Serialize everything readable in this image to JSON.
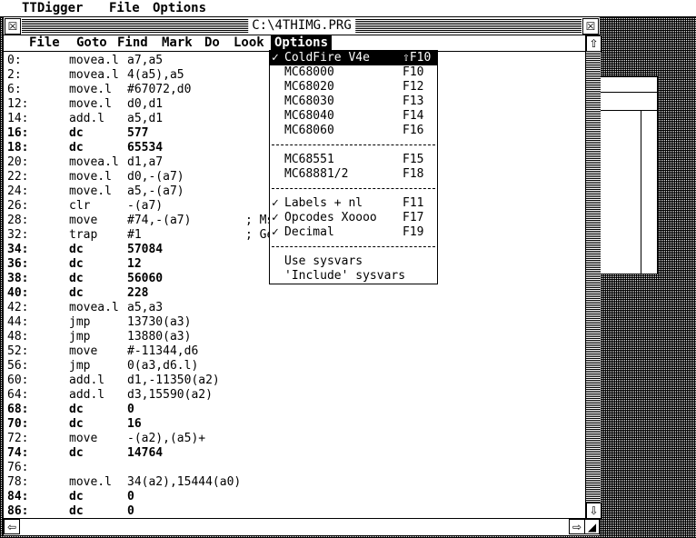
{
  "app_menu": [
    "TTDigger",
    "File",
    "Options"
  ],
  "window": {
    "title": "C:\\4THIMG.PRG",
    "menu": [
      "File",
      "Goto",
      "Find",
      "Mark",
      "Do",
      "Look",
      "Options"
    ],
    "active_menu": "Options"
  },
  "listing": [
    {
      "addr": "0:",
      "op": "movea.l",
      "arg": "a7,a5",
      "bold": false
    },
    {
      "addr": "2:",
      "op": "movea.l",
      "arg": "4(a5),a5",
      "bold": false
    },
    {
      "addr": "6:",
      "op": "move.l",
      "arg": "#67072,d0",
      "bold": false
    },
    {
      "addr": "12:",
      "op": "move.l",
      "arg": "d0,d1",
      "bold": false
    },
    {
      "addr": "14:",
      "op": "add.l",
      "arg": "a5,d1",
      "bold": false
    },
    {
      "addr": "16:",
      "op": "dc",
      "arg": "577",
      "bold": true
    },
    {
      "addr": "18:",
      "op": "dc",
      "arg": "65534",
      "bold": true
    },
    {
      "addr": "20:",
      "op": "movea.l",
      "arg": "d1,a7",
      "bold": false
    },
    {
      "addr": "22:",
      "op": "move.l",
      "arg": "d0,-(a7)",
      "bold": false
    },
    {
      "addr": "24:",
      "op": "move.l",
      "arg": "a5,-(a7)",
      "bold": false
    },
    {
      "addr": "26:",
      "op": "clr",
      "arg": "-(a7)",
      "bold": false
    },
    {
      "addr": "28:",
      "op": "move",
      "arg": "#74,-(a7)",
      "cmt": "; Ms",
      "bold": false
    },
    {
      "addr": "32:",
      "op": "trap",
      "arg": "#1",
      "cmt": "; Ge",
      "bold": false
    },
    {
      "addr": "34:",
      "op": "dc",
      "arg": "57084",
      "bold": true
    },
    {
      "addr": "36:",
      "op": "dc",
      "arg": "12",
      "bold": true
    },
    {
      "addr": "38:",
      "op": "dc",
      "arg": "56060",
      "bold": true
    },
    {
      "addr": "40:",
      "op": "dc",
      "arg": "228",
      "bold": true
    },
    {
      "addr": "42:",
      "op": "movea.l",
      "arg": "a5,a3",
      "bold": false
    },
    {
      "addr": "44:",
      "op": "jmp",
      "arg": "13730(a3)",
      "bold": false
    },
    {
      "addr": "48:",
      "op": "jmp",
      "arg": "13880(a3)",
      "bold": false
    },
    {
      "addr": "52:",
      "op": "move",
      "arg": "#-11344,d6",
      "bold": false
    },
    {
      "addr": "56:",
      "op": "jmp",
      "arg": "0(a3,d6.l)",
      "bold": false
    },
    {
      "addr": "60:",
      "op": "add.l",
      "arg": "d1,-11350(a2)",
      "bold": false
    },
    {
      "addr": "64:",
      "op": "add.l",
      "arg": "d3,15590(a2)",
      "bold": false
    },
    {
      "addr": "68:",
      "op": "dc",
      "arg": "0",
      "bold": true
    },
    {
      "addr": "70:",
      "op": "dc",
      "arg": "16",
      "bold": true
    },
    {
      "addr": "72:",
      "op": "move",
      "arg": "-(a2),(a5)+",
      "bold": false
    },
    {
      "addr": "74:",
      "op": "dc",
      "arg": "14764",
      "bold": true
    },
    {
      "addr": "76:",
      "op": "",
      "arg": "",
      "bold": false
    },
    {
      "addr": "78:",
      "op": "move.l",
      "arg": "34(a2),15444(a0)",
      "bold": false
    },
    {
      "addr": "84:",
      "op": "dc",
      "arg": "0",
      "bold": true
    },
    {
      "addr": "86:",
      "op": "dc",
      "arg": "0",
      "bold": true
    }
  ],
  "options_menu": {
    "items": [
      {
        "check": "✓",
        "label": "ColdFire V4e",
        "key": "⇧F10",
        "selected": true
      },
      {
        "check": "",
        "label": "MC68000",
        "key": "F10"
      },
      {
        "check": "",
        "label": "MC68020",
        "key": "F12"
      },
      {
        "check": "",
        "label": "MC68030",
        "key": "F13"
      },
      {
        "check": "",
        "label": "MC68040",
        "key": "F14"
      },
      {
        "check": "",
        "label": "MC68060",
        "key": "F16"
      },
      {
        "sep": true
      },
      {
        "check": "",
        "label": "MC68551",
        "key": "F15"
      },
      {
        "check": "",
        "label": "MC68881/2",
        "key": "F18"
      },
      {
        "sep": true
      },
      {
        "check": "✓",
        "label": "Labels + nl",
        "key": "F11"
      },
      {
        "check": "✓",
        "label": "Opcodes Xoooo",
        "key": "F17"
      },
      {
        "check": "✓",
        "label": "Decimal",
        "key": "F19"
      },
      {
        "sep": true
      },
      {
        "check": "",
        "label": "Use sysvars",
        "key": ""
      },
      {
        "check": "",
        "label": "'Include' sysvars",
        "key": ""
      }
    ]
  },
  "controls": {
    "close_glyph": "☒",
    "full_glyph": "☒",
    "up_glyph": "⇧",
    "down_glyph": "⇩",
    "left_glyph": "⇦",
    "right_glyph": "⇨",
    "size_glyph": "◢"
  }
}
